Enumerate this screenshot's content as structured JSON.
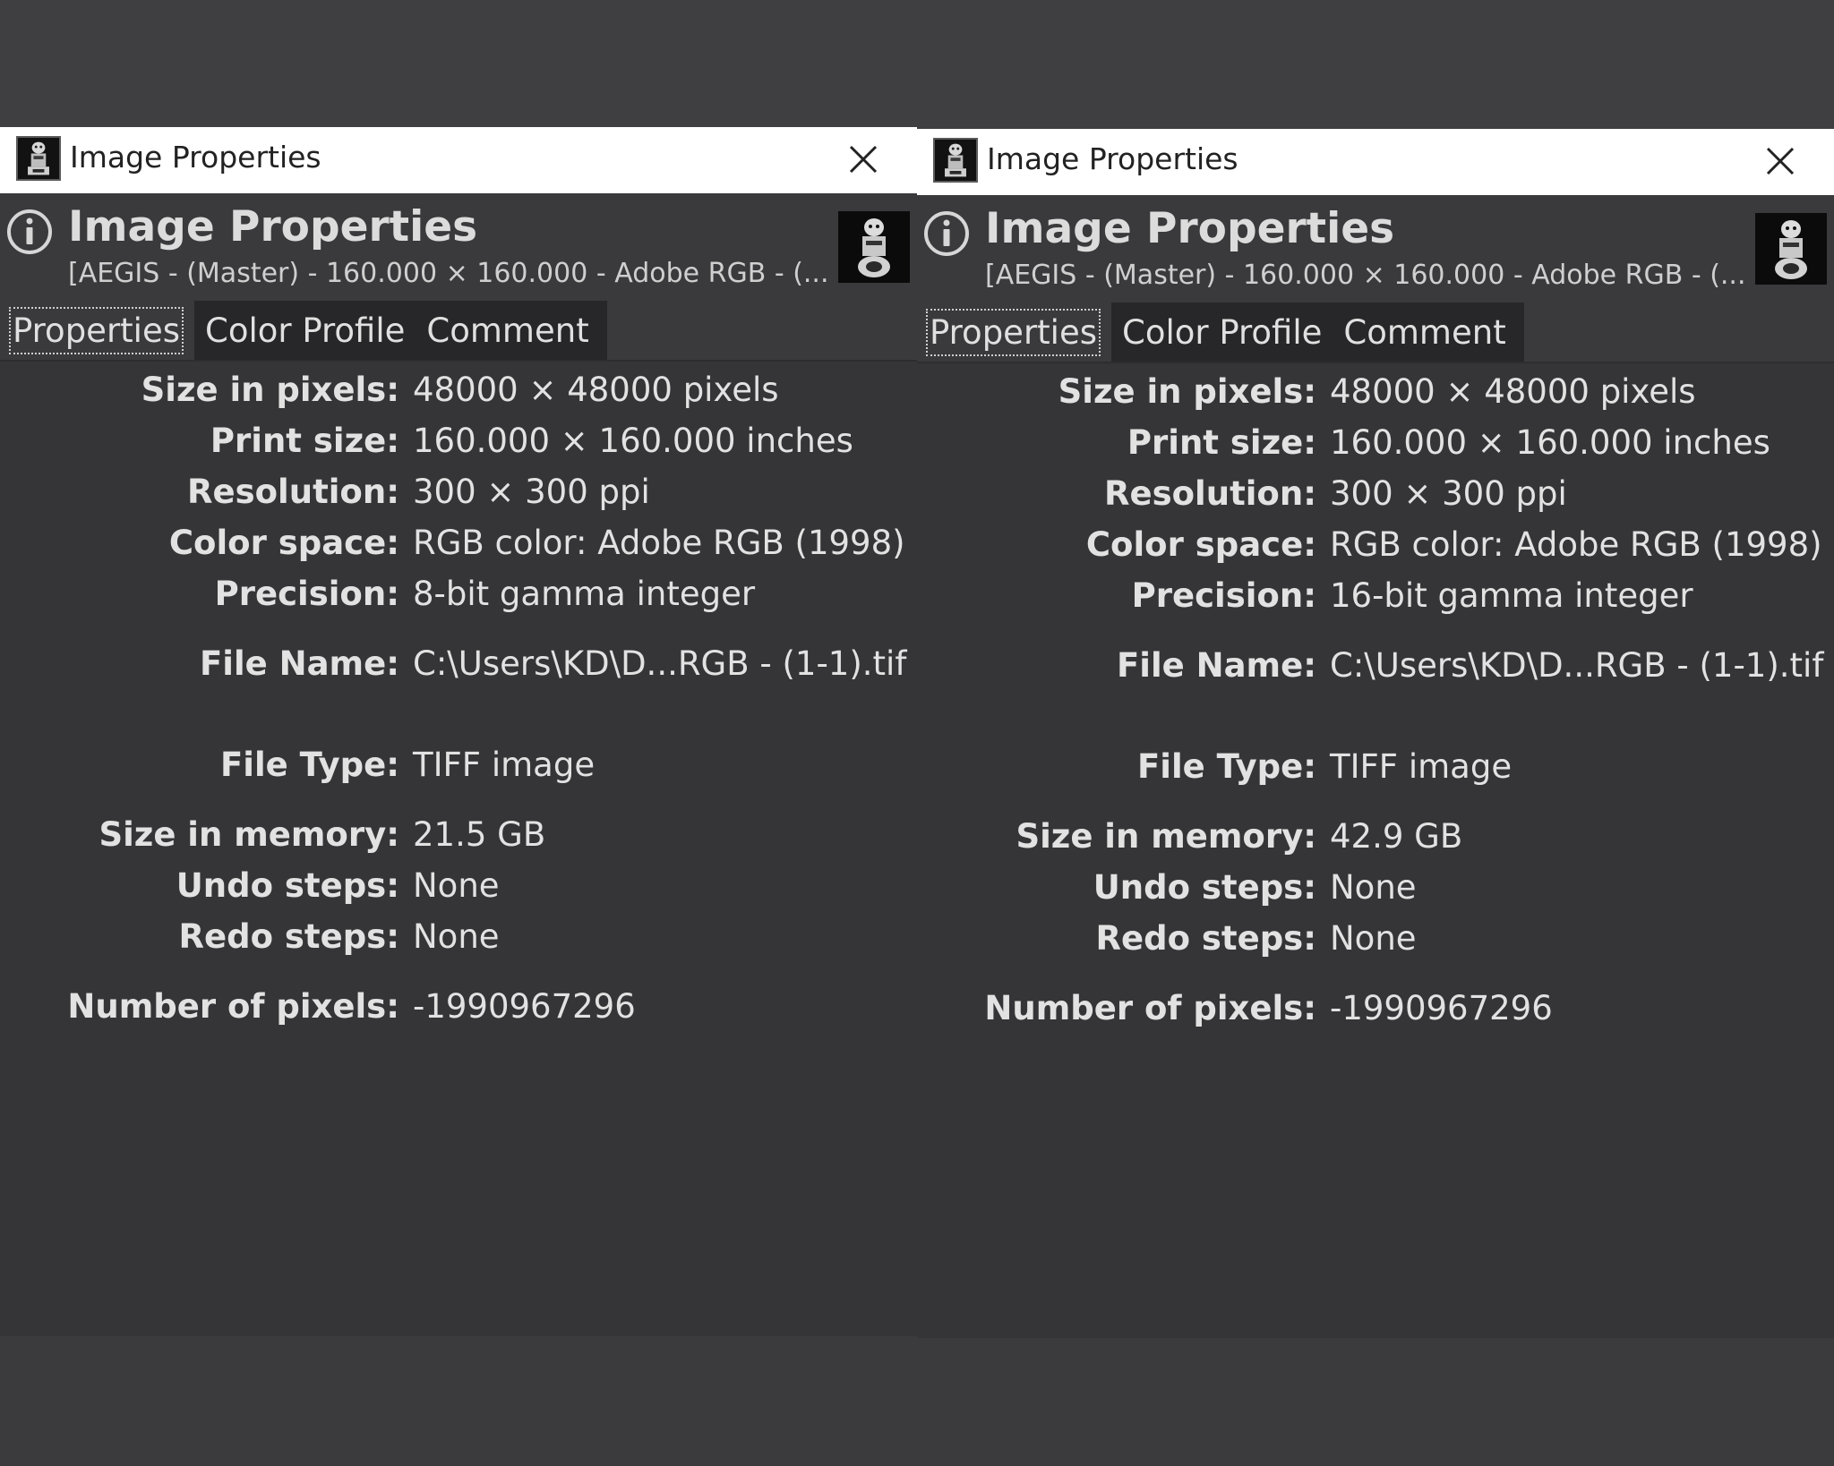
{
  "screens": [
    {
      "window": {
        "title": "Image Properties",
        "close_glyph": "×"
      },
      "header": {
        "title": "Image Properties",
        "subtitle": "[AEGIS - (Master) - 160.000 × 160.000 - Adobe RGB - (..."
      },
      "tabs": [
        {
          "label": "Properties",
          "active": true
        },
        {
          "label": "Color Profile",
          "active": false
        },
        {
          "label": "Comment",
          "active": false
        }
      ],
      "properties": [
        {
          "label": "Size in pixels:",
          "value": "48000 × 48000 pixels"
        },
        {
          "label": "Print size:",
          "value": "160.000 × 160.000 inches"
        },
        {
          "label": "Resolution:",
          "value": "300 × 300 ppi"
        },
        {
          "label": "Color space:",
          "value": "RGB color: Adobe RGB (1998)"
        },
        {
          "label": "Precision:",
          "value": "8-bit gamma integer"
        },
        {
          "label": "File Name:",
          "value": "C:\\Users\\KD\\D...RGB - (1-1).tif"
        },
        {
          "label": "File Type:",
          "value": "TIFF image"
        },
        {
          "label": "Size in memory:",
          "value": "21.5 GB"
        },
        {
          "label": "Undo steps:",
          "value": "None"
        },
        {
          "label": "Redo steps:",
          "value": "None"
        },
        {
          "label": "Number of pixels:",
          "value": "-1990967296"
        }
      ]
    },
    {
      "window": {
        "title": "Image Properties",
        "close_glyph": "×"
      },
      "header": {
        "title": "Image Properties",
        "subtitle": "[AEGIS - (Master) - 160.000 × 160.000 - Adobe RGB - (..."
      },
      "tabs": [
        {
          "label": "Properties",
          "active": true
        },
        {
          "label": "Color Profile",
          "active": false
        },
        {
          "label": "Comment",
          "active": false
        }
      ],
      "properties": [
        {
          "label": "Size in pixels:",
          "value": "48000 × 48000 pixels"
        },
        {
          "label": "Print size:",
          "value": "160.000 × 160.000 inches"
        },
        {
          "label": "Resolution:",
          "value": "300 × 300 ppi"
        },
        {
          "label": "Color space:",
          "value": "RGB color: Adobe RGB (1998)"
        },
        {
          "label": "Precision:",
          "value": "16-bit gamma integer"
        },
        {
          "label": "File Name:",
          "value": "C:\\Users\\KD\\D...RGB - (1-1).tif"
        },
        {
          "label": "File Type:",
          "value": "TIFF image"
        },
        {
          "label": "Size in memory:",
          "value": "42.9 GB"
        },
        {
          "label": "Undo steps:",
          "value": "None"
        },
        {
          "label": "Redo steps:",
          "value": "None"
        },
        {
          "label": "Number of pixels:",
          "value": "-1990967296"
        }
      ]
    }
  ],
  "icons": {
    "app": "aegis-statue-icon",
    "close": "close-icon",
    "info": "info-icon",
    "thumbnail": "image-thumbnail"
  },
  "colors": {
    "background": "#3f3f41",
    "dialog": "#353537",
    "titlebar": "#ffffff",
    "text": "#e2e2e2",
    "tab_inactive": "#272729"
  }
}
